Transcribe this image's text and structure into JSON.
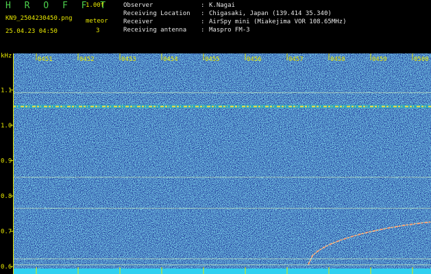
{
  "header": {
    "title": "H R O F F T",
    "version": "1.00f",
    "filename": "KN9_2504230450.png",
    "timestamp": "25.04.23 04:50",
    "meteor_label": "meteor",
    "meteor_count": "3"
  },
  "info": [
    {
      "label": "Observer",
      "sep": ":",
      "value": "K.Nagai"
    },
    {
      "label": "Receiving Location",
      "sep": ":",
      "value": "Chigasaki, Japan (139.414 35.340)"
    },
    {
      "label": "Receiver",
      "sep": ":",
      "value": "AirSpy mini (Miakejima VOR 108.65MHz)"
    },
    {
      "label": "Receiving antenna",
      "sep": ":",
      "value": "Maspro FM-3"
    }
  ],
  "spectrogram": {
    "y_unit": "kHz",
    "y_ticks": [
      {
        "label": "1.1",
        "value": 1.1
      },
      {
        "label": "1.0",
        "value": 1.0
      },
      {
        "label": "0.9",
        "value": 0.9
      },
      {
        "label": "0.8",
        "value": 0.8
      },
      {
        "label": "0.7",
        "value": 0.7
      },
      {
        "label": "0.6",
        "value": 0.6
      }
    ],
    "y_range": [
      0.579,
      1.215
    ],
    "time_ticks": [
      "0451",
      "0452",
      "0453",
      "0454",
      "0455",
      "0456",
      "0457",
      "0458",
      "0459",
      "0500"
    ],
    "carrier_khz": 1.053,
    "faint_lines_khz": [
      1.092,
      0.853,
      0.765,
      0.622,
      0.605
    ],
    "colors": {
      "background": "#10208c",
      "noise": "#3070e0",
      "carrier": "#ffe040",
      "axis": "#e8e800",
      "bottom_bar": "#30d0f0"
    }
  }
}
